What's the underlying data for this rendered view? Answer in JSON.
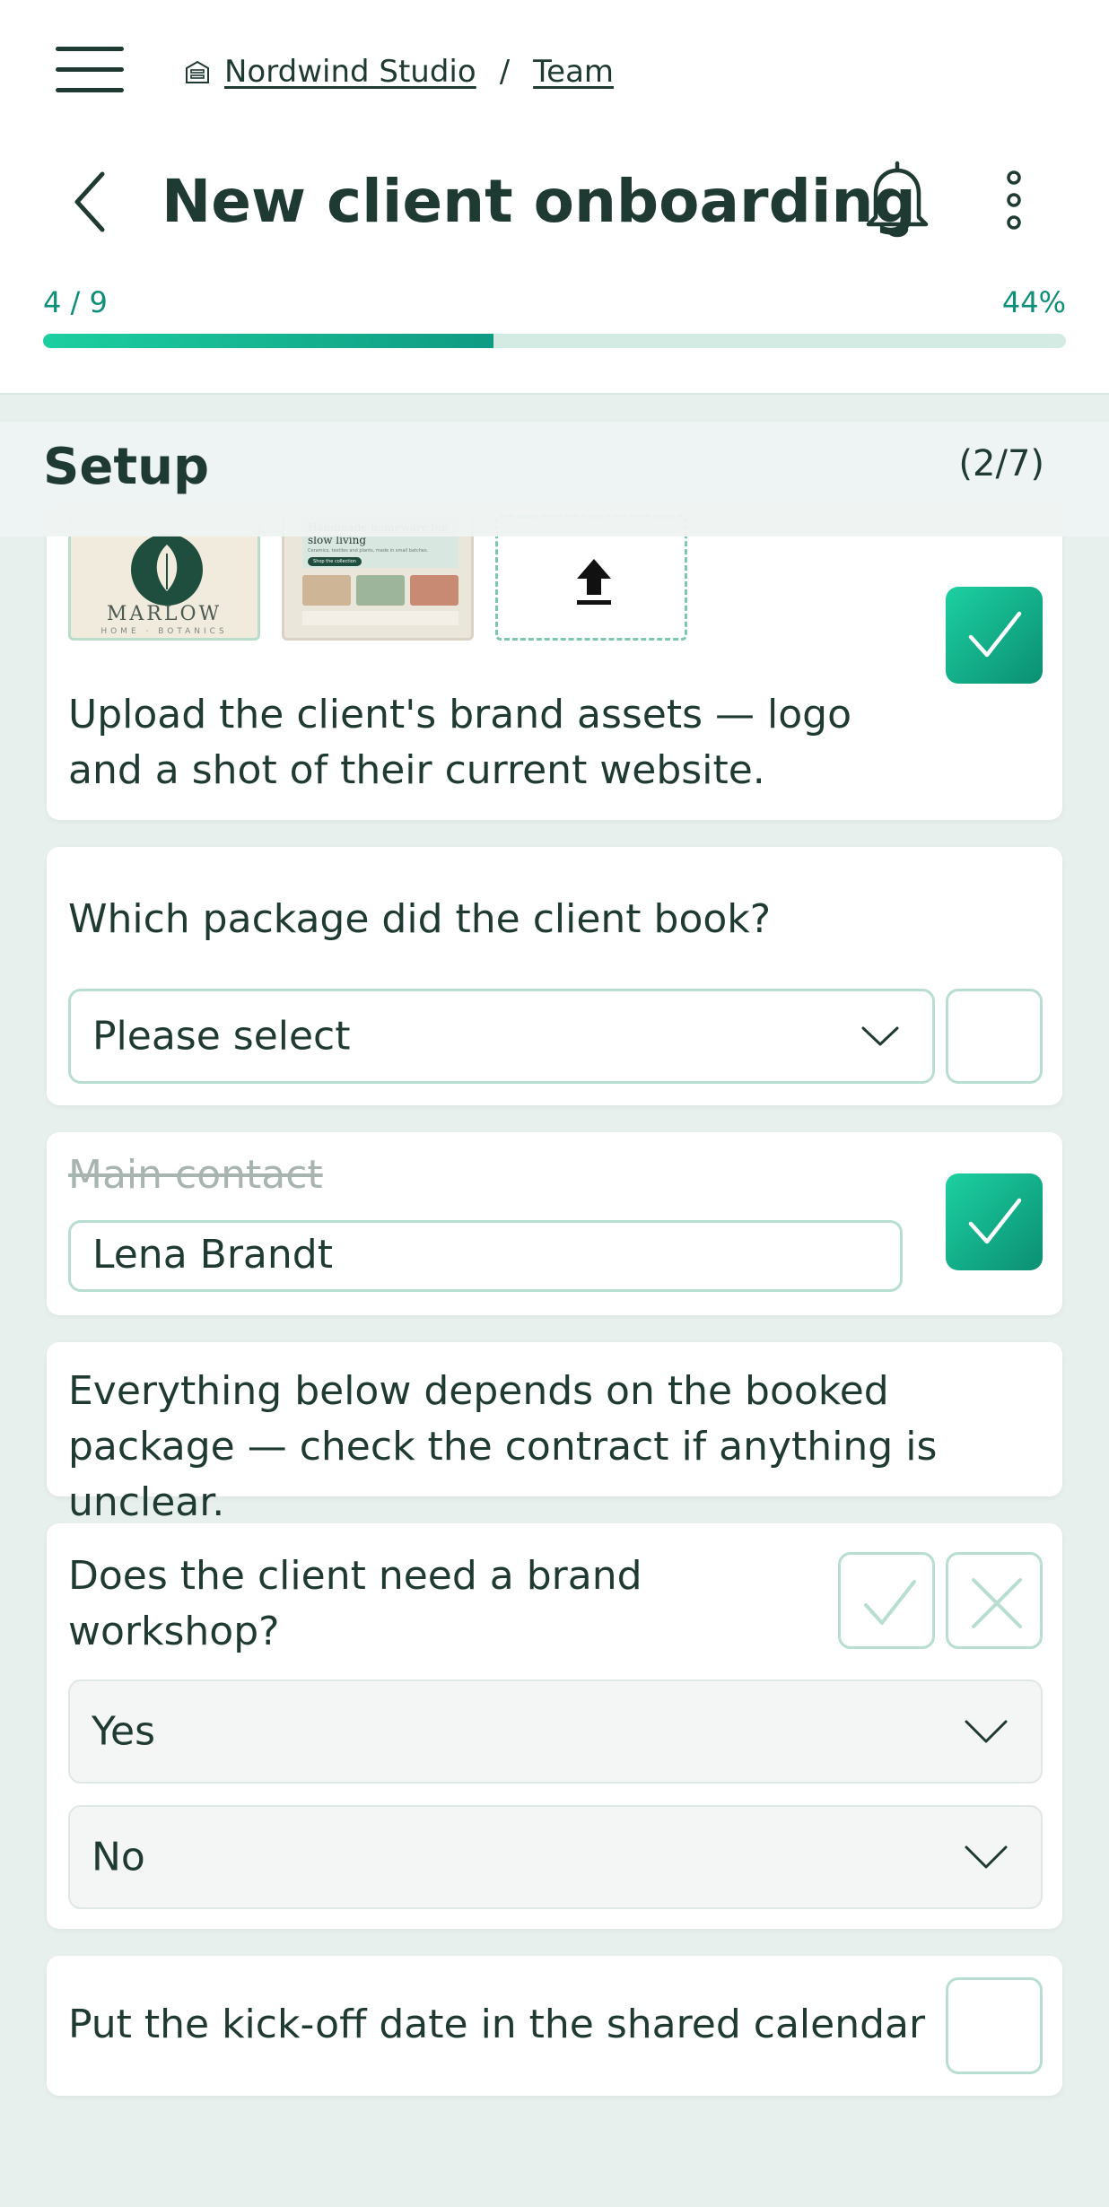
{
  "breadcrumb": {
    "org": "Nordwind Studio",
    "separator": "/",
    "team": "Team"
  },
  "header": {
    "title": "New client onboarding"
  },
  "progress": {
    "count": "4 / 9",
    "percent_label": "44%",
    "value": 0.44
  },
  "section": {
    "title": "Setup",
    "count": "(2/7)"
  },
  "cards": {
    "brand_assets": {
      "text": "Upload the client's brand assets — logo and a shot of their current website.",
      "checked": true,
      "logo": {
        "brand": "MARLOW",
        "tagline": "HOME · BOTANICS"
      },
      "website": {
        "headline": "Handmade homeware for slow living",
        "sub": "Ceramics, textiles and plants, made in small batches.",
        "cta": "Shop the collection"
      }
    },
    "package": {
      "question": "Which package did the client book?",
      "placeholder": "Please select",
      "checked": false
    },
    "contact": {
      "label": "Main contact",
      "value": "Lena Brandt",
      "checked": true
    },
    "note": {
      "text": "Everything below depends on the booked package — check the contract if anything is unclear."
    },
    "workshop": {
      "question": "Does the client need a brand workshop?",
      "option_yes": "Yes",
      "option_no": "No"
    },
    "kickoff": {
      "text": "Put the kick-off date in the shared calendar",
      "checked": false
    }
  },
  "colors": {
    "accent": "#0f9b82",
    "accent_light": "#1cd0a2",
    "text": "#1f3a32",
    "background": "#e8f0ee"
  }
}
